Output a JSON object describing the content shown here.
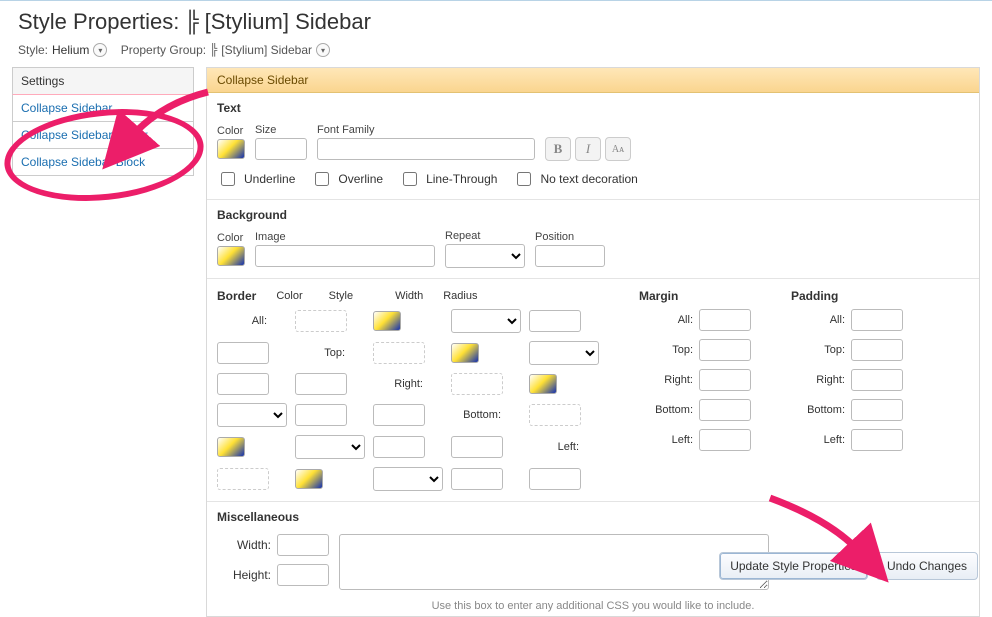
{
  "header": {
    "title_prefix": "Style Properties:",
    "title_icon_glyph": "╠",
    "title_subject": "[Stylium] Sidebar"
  },
  "breadcrumb": {
    "style_label": "Style:",
    "style_value": "Helium",
    "group_label": "Property Group:",
    "group_icon_glyph": "╠",
    "group_value": "[Stylium] Sidebar"
  },
  "sidebar": {
    "heading": "Settings",
    "items": [
      {
        "label": "Collapse Sidebar"
      },
      {
        "label": "Collapse Sidebar Hover"
      },
      {
        "label": "Collapse Sidebar Block"
      }
    ]
  },
  "panel": {
    "title": "Collapse Sidebar",
    "text_section": {
      "heading": "Text",
      "color_label": "Color",
      "size_label": "Size",
      "size_value": "",
      "font_family_label": "Font Family",
      "font_family_value": "",
      "bold_glyph": "B",
      "italic_glyph": "I",
      "case_glyph": "Aᴀ",
      "underline_label": "Underline",
      "overline_label": "Overline",
      "linethrough_label": "Line-Through",
      "none_label": "No text decoration"
    },
    "background_section": {
      "heading": "Background",
      "color_label": "Color",
      "image_label": "Image",
      "image_value": "",
      "repeat_label": "Repeat",
      "repeat_value": "",
      "position_label": "Position",
      "position_value": ""
    },
    "border_section": {
      "heading": "Border",
      "col_color": "Color",
      "col_style": "Style",
      "col_width": "Width",
      "col_radius": "Radius",
      "rows": [
        "All:",
        "Top:",
        "Right:",
        "Bottom:",
        "Left:"
      ]
    },
    "margin_section": {
      "heading": "Margin",
      "rows": [
        "All:",
        "Top:",
        "Right:",
        "Bottom:",
        "Left:"
      ],
      "values": [
        "",
        "",
        "",
        "",
        ""
      ]
    },
    "padding_section": {
      "heading": "Padding",
      "rows": [
        "All:",
        "Top:",
        "Right:",
        "Bottom:",
        "Left:"
      ],
      "values": [
        "",
        "",
        "",
        "",
        ""
      ]
    },
    "misc_section": {
      "heading": "Miscellaneous",
      "width_label": "Width:",
      "width_value": "",
      "height_label": "Height:",
      "height_value": "",
      "extra_css_value": "",
      "hint": "Use this box to enter any additional CSS you would like to include."
    }
  },
  "actions": {
    "update_label": "Update Style Properties",
    "undo_label": "Undo Changes"
  }
}
